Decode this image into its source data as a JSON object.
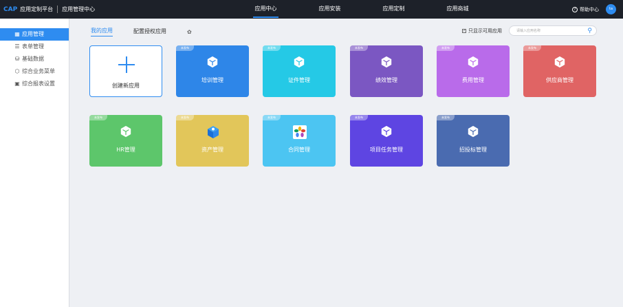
{
  "header": {
    "brand_cap": "CAP",
    "brand_name": "应用定制平台",
    "subtitle": "应用管理中心",
    "nav": [
      "应用中心",
      "应用安装",
      "应用定制",
      "应用商城"
    ],
    "help": "帮助中心",
    "avatar": "ta"
  },
  "sidebar": {
    "items": [
      {
        "icon": "grid-icon",
        "label": "应用管理"
      },
      {
        "icon": "layers-icon",
        "label": "表单管理"
      },
      {
        "icon": "database-icon",
        "label": "基础数据"
      },
      {
        "icon": "cube-icon",
        "label": "综合业务菜单"
      },
      {
        "icon": "chart-icon",
        "label": "综合报表设置"
      }
    ]
  },
  "main": {
    "tabs": [
      "我的应用",
      "配置授权应用"
    ],
    "filter_label": "只显示可用应用",
    "search_placeholder": "请输入应用名称",
    "create_label": "创建新应用",
    "badge": "未发布",
    "apps": [
      {
        "label": "培训管理",
        "color": "#2e86e8"
      },
      {
        "label": "证件管理",
        "color": "#25c9e6"
      },
      {
        "label": "绩效管理",
        "color": "#7b57c2"
      },
      {
        "label": "费用管理",
        "color": "#b96bea"
      },
      {
        "label": "供应商管理",
        "color": "#e06464"
      },
      {
        "label": "HR管理",
        "color": "#5dc66b"
      },
      {
        "label": "资产管理",
        "color": "#e2c65a"
      },
      {
        "label": "合同管理",
        "color": "#4cc5f2"
      },
      {
        "label": "项目任务管理",
        "color": "#5e45e2"
      },
      {
        "label": "招投标管理",
        "color": "#4a6bb0"
      }
    ]
  }
}
